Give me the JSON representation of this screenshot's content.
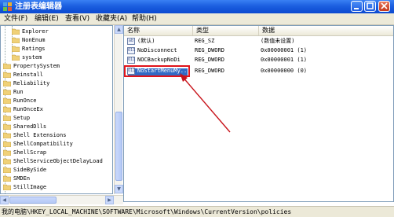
{
  "window": {
    "title": "注册表编辑器"
  },
  "menu": [
    "文件(F)",
    "编辑(E)",
    "查看(V)",
    "收藏夹(A)",
    "帮助(H)"
  ],
  "tree": {
    "items": [
      {
        "label": "Explorer"
      },
      {
        "label": "NonEnum"
      },
      {
        "label": "Ratings"
      },
      {
        "label": "system"
      },
      {
        "label": "PropertySystem"
      },
      {
        "label": "Reinstall"
      },
      {
        "label": "Reliability"
      },
      {
        "label": "Run"
      },
      {
        "label": "RunOnce"
      },
      {
        "label": "RunOnceEx"
      },
      {
        "label": "Setup"
      },
      {
        "label": "SharedDlls"
      },
      {
        "label": "Shell Extensions"
      },
      {
        "label": "ShellCompatibility"
      },
      {
        "label": "ShellScrap"
      },
      {
        "label": "ShellServiceObjectDelayLoad"
      },
      {
        "label": "SideBySide"
      },
      {
        "label": "SMDEn"
      },
      {
        "label": "StillImage"
      }
    ]
  },
  "list": {
    "headers": {
      "name": "名称",
      "type": "类型",
      "data": "数据"
    },
    "rows": [
      {
        "icon": "ab",
        "name": "(默认)",
        "type": "REG_SZ",
        "data": "(数值未设置)"
      },
      {
        "icon": "011",
        "name": "NoDisconnect",
        "type": "REG_DWORD",
        "data": "0x00000001 (1)"
      },
      {
        "icon": "011",
        "name": "NOCBackupNoDi",
        "type": "REG_DWORD",
        "data": "0x00000001 (1)"
      },
      {
        "icon": "011",
        "name": "NoStartMenuMy...",
        "type": "REG_DWORD",
        "data": "0x00000000 (0)"
      }
    ]
  },
  "status": {
    "path": "我的电脑\\HKEY_LOCAL_MACHINE\\SOFTWARE\\Microsoft\\Windows\\CurrentVersion\\policies"
  },
  "colors": {
    "selection": "#316ac5",
    "highlight_box": "#e0141a",
    "arrow": "#c8141b",
    "titlebar": "#1c5fe0"
  }
}
